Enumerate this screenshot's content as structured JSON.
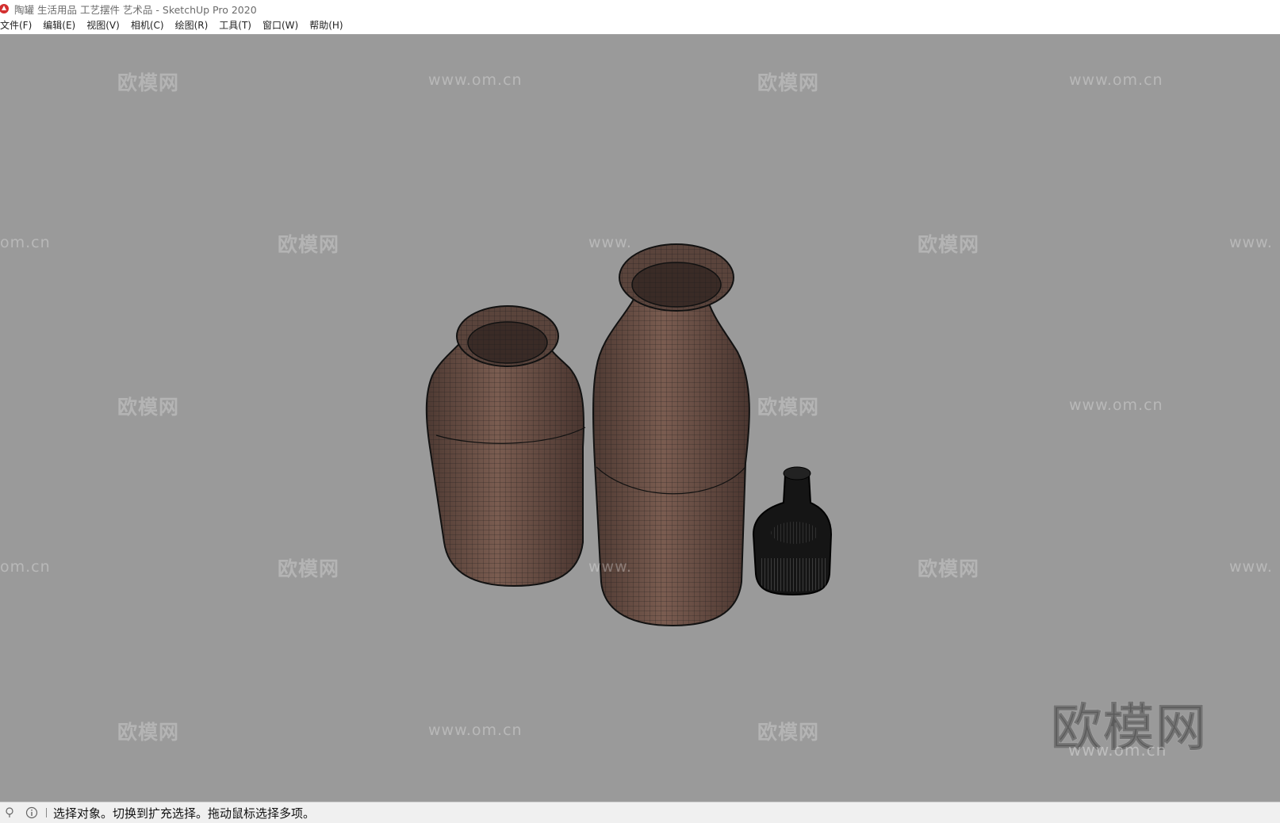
{
  "window": {
    "title": "陶罐 生活用品 工艺摆件 艺术品 - SketchUp Pro 2020"
  },
  "menu": {
    "items": [
      "文件(F)",
      "编辑(E)",
      "视图(V)",
      "相机(C)",
      "绘图(R)",
      "工具(T)",
      "窗口(W)",
      "帮助(H)"
    ]
  },
  "watermarks": {
    "brand": "欧模网",
    "url": "www.om.cn",
    "url_partial_left": "om.cn",
    "url_partial_right": "www.",
    "big_brand": "欧模网",
    "big_url": "www.om.cn"
  },
  "status": {
    "icons": [
      "geo-location-icon",
      "info-icon"
    ],
    "text": "选择对象。切换到扩充选择。拖动鼠标选择多项。"
  },
  "colors": {
    "viewport_bg": "#9a9a9a",
    "model_wood": "#6b5046",
    "wireframe": "#1a1a1a",
    "logo_red": "#d32f2f"
  }
}
